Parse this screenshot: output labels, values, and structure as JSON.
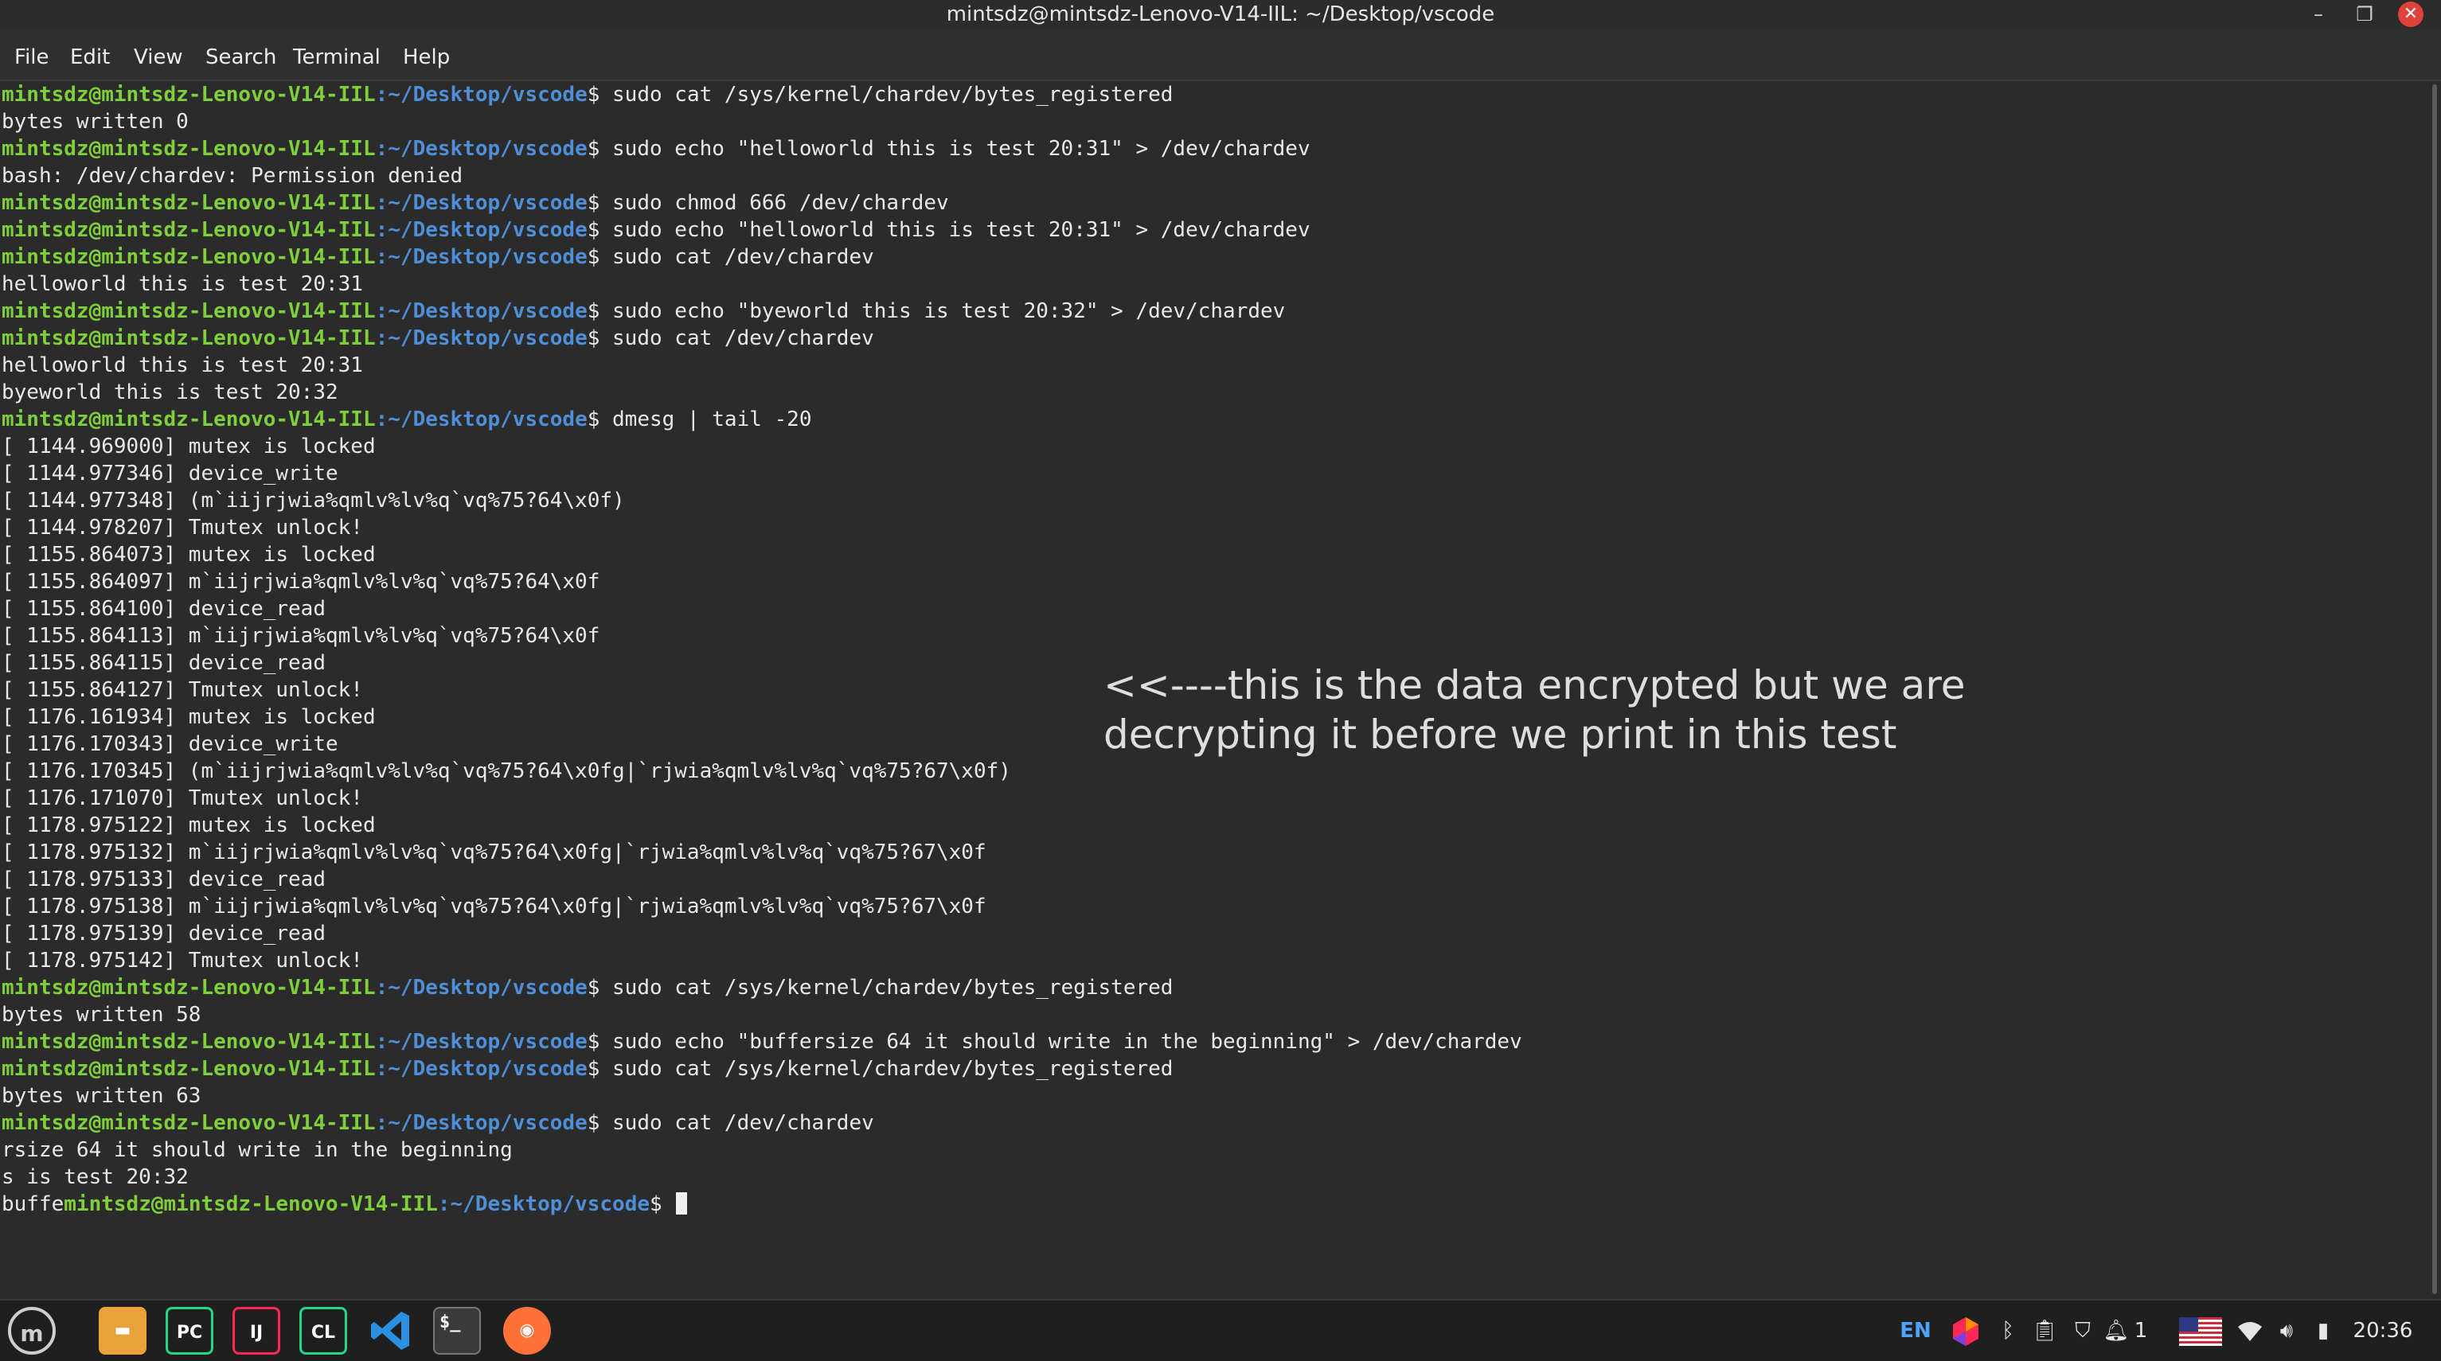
{
  "window": {
    "title": "mintsdz@mintsdz-Lenovo-V14-IIL: ~/Desktop/vscode",
    "minimize_glyph": "–",
    "maximize_glyph": "❐",
    "close_glyph": "✕"
  },
  "menu": [
    "File",
    "Edit",
    "View",
    "Search",
    "Terminal",
    "Help"
  ],
  "prompt": {
    "user_host": "mintsdz@mintsdz-Lenovo-V14-IIL",
    "path": ":~/Desktop/vscode",
    "symbol": "$ "
  },
  "terminal": {
    "lines": [
      {
        "type": "cmd",
        "cmd": "sudo cat /sys/kernel/chardev/bytes_registered"
      },
      {
        "type": "out",
        "text": "bytes written 0"
      },
      {
        "type": "cmd",
        "cmd": "sudo echo \"helloworld this is test 20:31\" > /dev/chardev"
      },
      {
        "type": "out",
        "text": "bash: /dev/chardev: Permission denied"
      },
      {
        "type": "cmd",
        "cmd": "sudo chmod 666 /dev/chardev"
      },
      {
        "type": "cmd",
        "cmd": "sudo echo \"helloworld this is test 20:31\" > /dev/chardev"
      },
      {
        "type": "cmd",
        "cmd": "sudo cat /dev/chardev"
      },
      {
        "type": "out",
        "text": "helloworld this is test 20:31"
      },
      {
        "type": "cmd",
        "cmd": "sudo echo \"byeworld this is test 20:32\" > /dev/chardev"
      },
      {
        "type": "cmd",
        "cmd": "sudo cat /dev/chardev"
      },
      {
        "type": "out",
        "text": "helloworld this is test 20:31"
      },
      {
        "type": "out",
        "text": "byeworld this is test 20:32"
      },
      {
        "type": "cmd",
        "cmd": "dmesg | tail -20"
      },
      {
        "type": "out",
        "text": "[ 1144.969000] mutex is locked"
      },
      {
        "type": "out",
        "text": "[ 1144.977346] device_write"
      },
      {
        "type": "out",
        "text": "[ 1144.977348] (m`iijrjwia%qmlv%lv%q`vq%75?64\\x0f)"
      },
      {
        "type": "out",
        "text": "[ 1144.978207] Tmutex unlock!"
      },
      {
        "type": "out",
        "text": "[ 1155.864073] mutex is locked"
      },
      {
        "type": "out",
        "text": "[ 1155.864097] m`iijrjwia%qmlv%lv%q`vq%75?64\\x0f"
      },
      {
        "type": "out",
        "text": "[ 1155.864100] device_read"
      },
      {
        "type": "out",
        "text": "[ 1155.864113] m`iijrjwia%qmlv%lv%q`vq%75?64\\x0f"
      },
      {
        "type": "out",
        "text": "[ 1155.864115] device_read"
      },
      {
        "type": "out",
        "text": "[ 1155.864127] Tmutex unlock!"
      },
      {
        "type": "out",
        "text": "[ 1176.161934] mutex is locked"
      },
      {
        "type": "out",
        "text": "[ 1176.170343] device_write"
      },
      {
        "type": "out",
        "text": "[ 1176.170345] (m`iijrjwia%qmlv%lv%q`vq%75?64\\x0fg|`rjwia%qmlv%lv%q`vq%75?67\\x0f)"
      },
      {
        "type": "out",
        "text": "[ 1176.171070] Tmutex unlock!"
      },
      {
        "type": "out",
        "text": "[ 1178.975122] mutex is locked"
      },
      {
        "type": "out",
        "text": "[ 1178.975132] m`iijrjwia%qmlv%lv%q`vq%75?64\\x0fg|`rjwia%qmlv%lv%q`vq%75?67\\x0f"
      },
      {
        "type": "out",
        "text": "[ 1178.975133] device_read"
      },
      {
        "type": "out",
        "text": "[ 1178.975138] m`iijrjwia%qmlv%lv%q`vq%75?64\\x0fg|`rjwia%qmlv%lv%q`vq%75?67\\x0f"
      },
      {
        "type": "out",
        "text": "[ 1178.975139] device_read"
      },
      {
        "type": "out",
        "text": "[ 1178.975142] Tmutex unlock!"
      },
      {
        "type": "cmd",
        "cmd": "sudo cat /sys/kernel/chardev/bytes_registered"
      },
      {
        "type": "out",
        "text": "bytes written 58"
      },
      {
        "type": "cmd",
        "cmd": "sudo echo \"buffersize 64 it should write in the beginning\" > /dev/chardev"
      },
      {
        "type": "cmd",
        "cmd": "sudo cat /sys/kernel/chardev/bytes_registered"
      },
      {
        "type": "out",
        "text": "bytes written 63"
      },
      {
        "type": "cmd",
        "cmd": "sudo cat /dev/chardev"
      },
      {
        "type": "out",
        "text": "rsize 64 it should write in the beginning"
      },
      {
        "type": "out",
        "text": "s is test 20:32"
      },
      {
        "type": "last",
        "prefix": "buffe",
        "cmd": ""
      }
    ]
  },
  "annotation": {
    "line1": "<<----this is the data encrypted but we are",
    "line2": "decrypting it before we print in this test"
  },
  "taskbar": {
    "apps": [
      {
        "name": "files-icon",
        "label": "",
        "color": "#e9a23b"
      },
      {
        "name": "pycharm-icon",
        "label": "PC",
        "color": "#21d789"
      },
      {
        "name": "intellij-icon",
        "label": "IJ",
        "color": "#fe2857"
      },
      {
        "name": "clion-icon",
        "label": "CL",
        "color": "#21d789"
      },
      {
        "name": "vscode-icon",
        "label": "",
        "color": "#2a8fe0"
      },
      {
        "name": "terminal-icon",
        "label": "$_",
        "color": "#3a3a3a"
      },
      {
        "name": "firefox-icon",
        "label": "",
        "color": "#ff7139"
      }
    ],
    "tray": {
      "language": "EN",
      "notifications": "1",
      "time": "20:36"
    }
  },
  "colors": {
    "prompt_user": "#7fcf3b",
    "prompt_path": "#4f8fd8",
    "terminal_bg": "#2b2b2b",
    "close_button": "#e0413a"
  }
}
